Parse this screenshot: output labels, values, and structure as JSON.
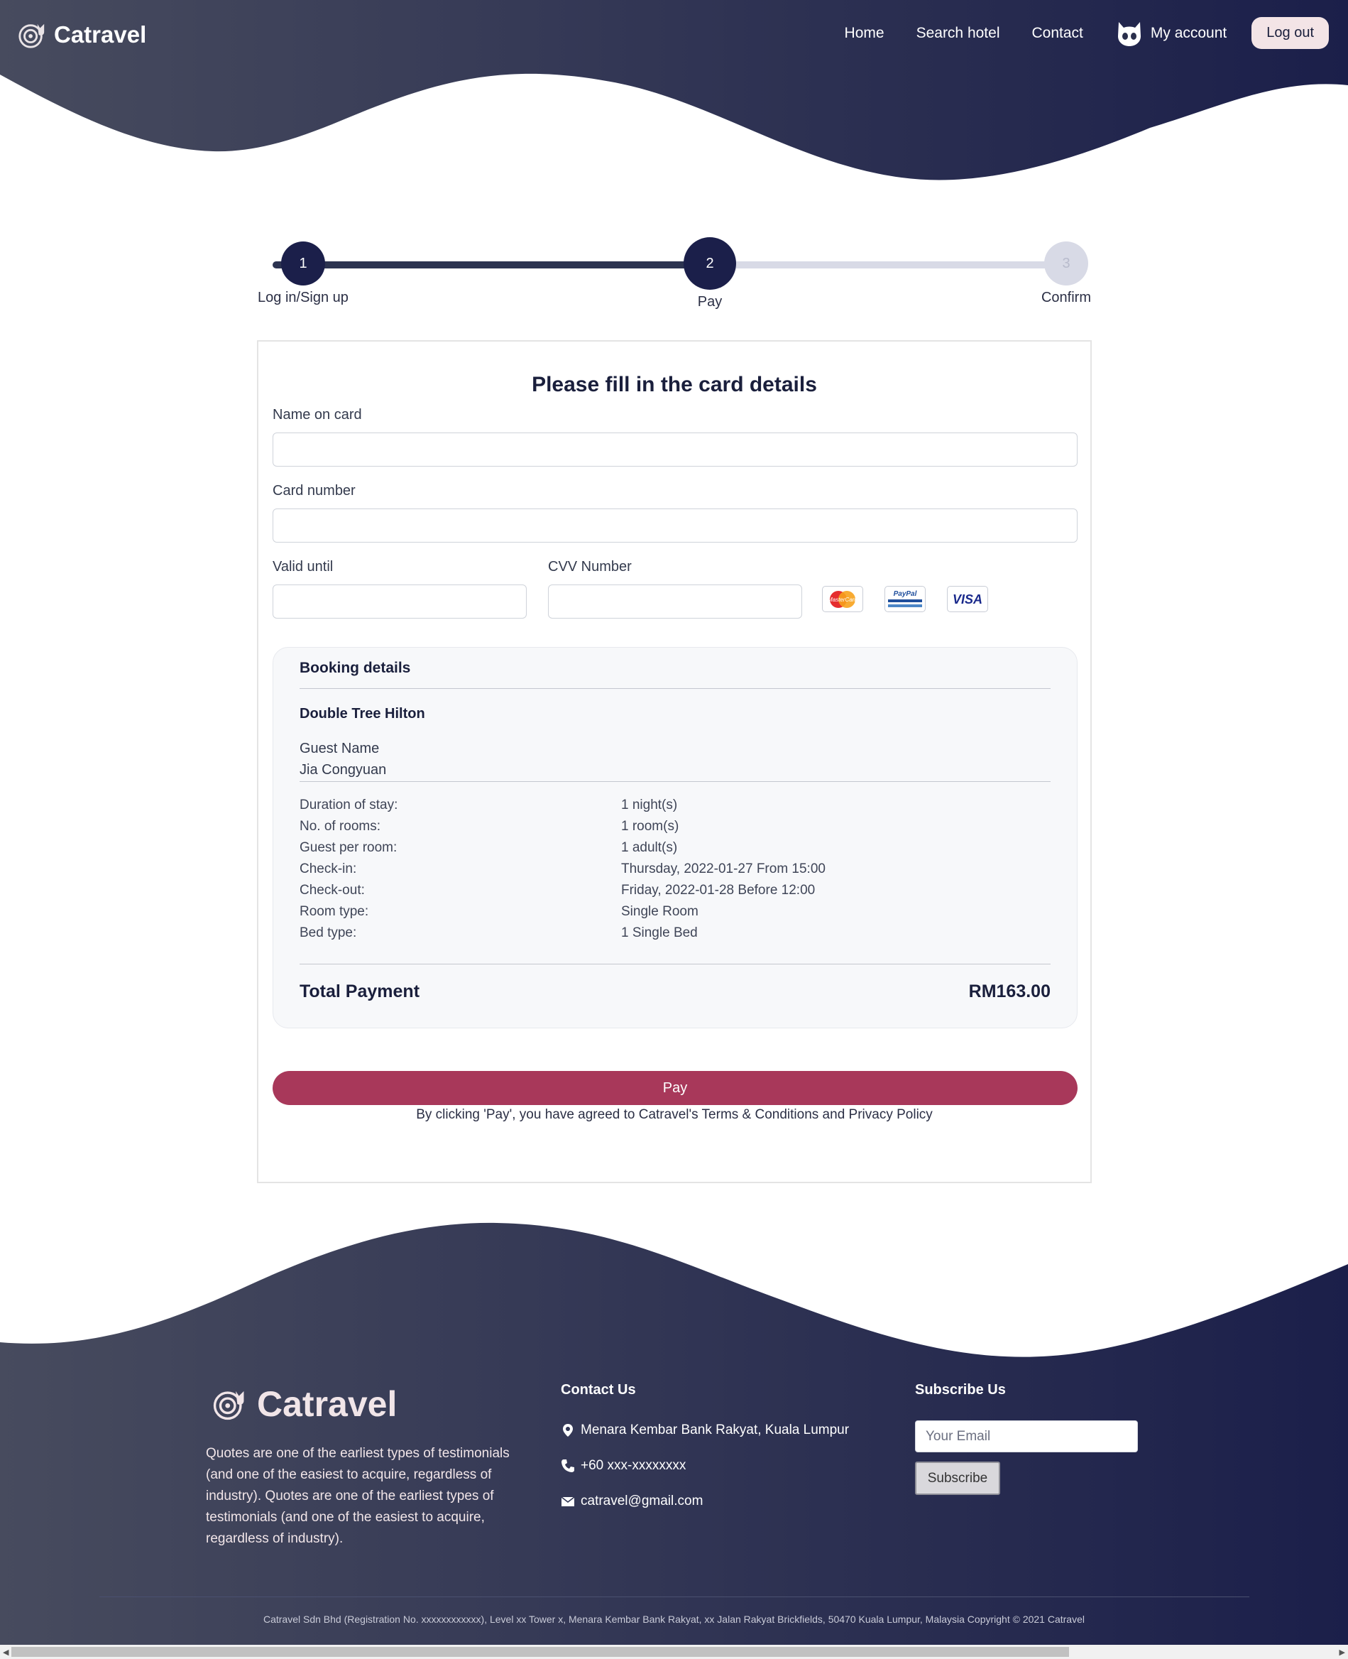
{
  "header": {
    "brand": "Catravel",
    "nav": {
      "home": "Home",
      "search_hotel": "Search hotel",
      "contact": "Contact",
      "my_account": "My account",
      "logout": "Log out"
    }
  },
  "stepper": {
    "steps": [
      {
        "number": "1",
        "label": "Log in/Sign up",
        "state": "done"
      },
      {
        "number": "2",
        "label": "Pay",
        "state": "current"
      },
      {
        "number": "3",
        "label": "Confirm",
        "state": "upcoming"
      }
    ]
  },
  "form": {
    "title": "Please fill in the card details",
    "name_on_card_label": "Name on card",
    "name_on_card_value": "",
    "card_number_label": "Card number",
    "card_number_value": "",
    "valid_until_label": "Valid until",
    "valid_until_value": "",
    "cvv_label": "CVV Number",
    "cvv_value": "",
    "payment_methods": [
      "MasterCard",
      "PayPal",
      "VISA"
    ]
  },
  "booking": {
    "title": "Booking details",
    "hotel": "Double Tree Hilton",
    "guest_name_label": "Guest Name",
    "guest_name": "Jia Congyuan",
    "details": [
      {
        "label": "Duration of stay:",
        "value": "1 night(s)"
      },
      {
        "label": "No. of rooms:",
        "value": "1 room(s)"
      },
      {
        "label": "Guest per room:",
        "value": "1 adult(s)"
      },
      {
        "label": "Check-in:",
        "value": "Thursday, 2022-01-27 From 15:00"
      },
      {
        "label": "Check-out:",
        "value": "Friday, 2022-01-28 Before 12:00"
      },
      {
        "label": "Room type:",
        "value": "Single Room"
      },
      {
        "label": "Bed type:",
        "value": "1 Single Bed"
      }
    ],
    "total_label": "Total Payment",
    "total_value": "RM163.00"
  },
  "pay_button": "Pay",
  "terms": "By clicking 'Pay', you have agreed to Catravel's Terms & Conditions and Privacy Policy",
  "footer": {
    "brand": "Catravel",
    "about": "Quotes are one of the earliest types of testimonials (and one of the easiest to acquire, regardless of industry). Quotes are one of the earliest types of testimonials (and one of the easiest to acquire, regardless of industry).",
    "contact_heading": "Contact Us",
    "address": "Menara Kembar Bank Rakyat, Kuala Lumpur",
    "phone": "+60 xxx-xxxxxxxx",
    "email": "catravel@gmail.com",
    "subscribe_heading": "Subscribe Us",
    "email_placeholder": "Your Email",
    "subscribe_button": "Subscribe",
    "copyright": "Catravel Sdn Bhd (Registration No. xxxxxxxxxxxx), Level xx Tower x, Menara Kembar Bank Rakyat, xx Jalan Rakyat Brickfields, 50470 Kuala Lumpur, Malaysia Copyright © 2021 Catravel"
  },
  "colors": {
    "navy": "#1b1f4a",
    "slate": "#474b5e",
    "accent_pay": "#a8385a",
    "step_upcoming": "#d8dae6"
  }
}
